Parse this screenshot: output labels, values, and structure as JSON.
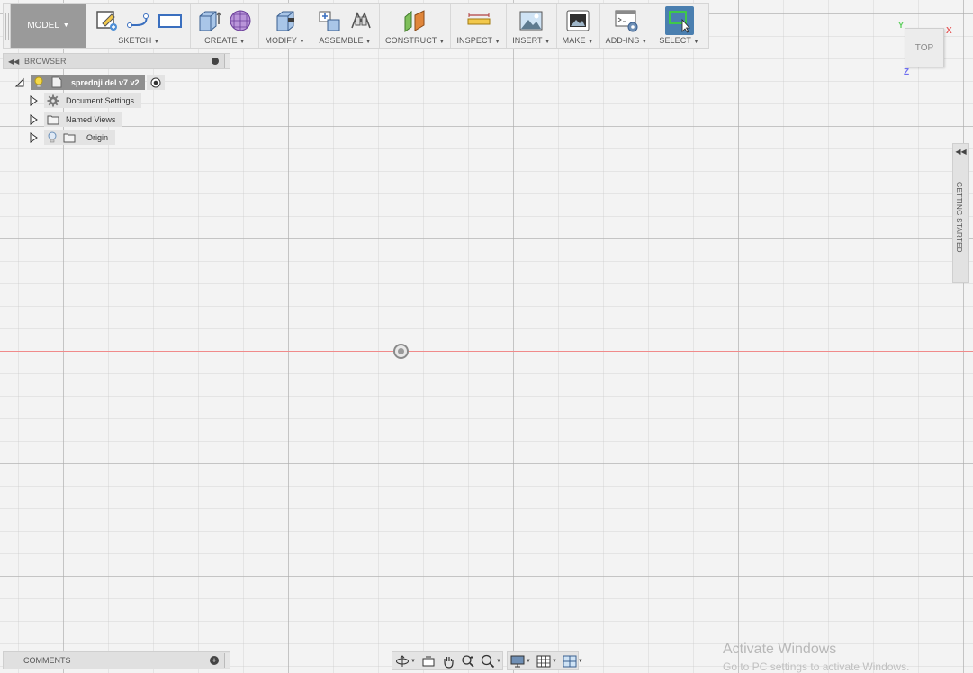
{
  "toolbar": {
    "workspace": "MODEL",
    "groups": [
      {
        "label": "SKETCH"
      },
      {
        "label": "CREATE"
      },
      {
        "label": "MODIFY"
      },
      {
        "label": "ASSEMBLE"
      },
      {
        "label": "CONSTRUCT"
      },
      {
        "label": "INSPECT"
      },
      {
        "label": "INSERT"
      },
      {
        "label": "MAKE"
      },
      {
        "label": "ADD-INS"
      },
      {
        "label": "SELECT"
      }
    ]
  },
  "browser": {
    "title": "BROWSER",
    "root": {
      "label": "sprednji del v7 v2"
    },
    "items": [
      {
        "label": "Document Settings"
      },
      {
        "label": "Named Views"
      },
      {
        "label": "Origin"
      }
    ]
  },
  "viewcube": {
    "face": "TOP",
    "axes": {
      "x": "X",
      "y": "Y",
      "z": "Z"
    }
  },
  "side_panel": {
    "label": "GETTING STARTED"
  },
  "comments": {
    "title": "COMMENTS"
  },
  "watermark": {
    "title": "Activate Windows",
    "subtitle": "Go to PC settings to activate Windows."
  },
  "colors": {
    "accent_select": "#4a7fb0",
    "axis_x": "#f08a8a",
    "axis_y": "#7f7fe6",
    "axis_label_x": "#e66060",
    "axis_label_y": "#5ccf5c",
    "axis_label_z": "#6f6ff0"
  }
}
